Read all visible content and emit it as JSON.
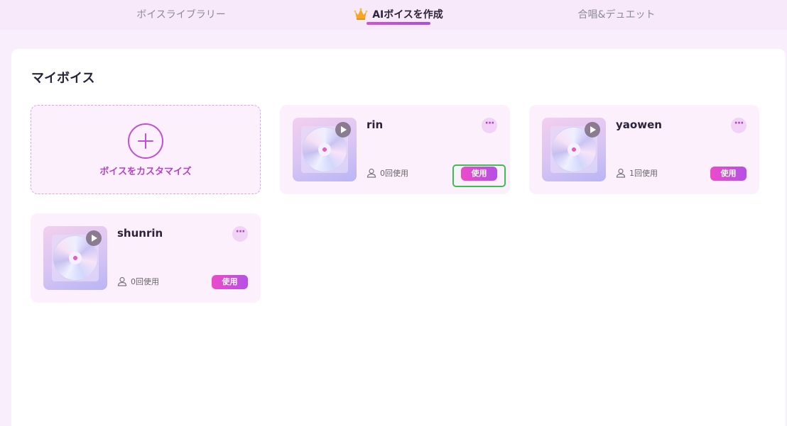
{
  "tabs": [
    {
      "label": "ボイスライブラリー",
      "active": false
    },
    {
      "label": "AIボイスを作成",
      "active": true,
      "icon": "crown-icon"
    },
    {
      "label": "合唱&デュエット",
      "active": false
    }
  ],
  "section": {
    "title": "マイボイス"
  },
  "add_card": {
    "label": "ボイスをカスタマイズ",
    "icon": "plus-circle-icon"
  },
  "voices": [
    {
      "name": "rin",
      "usage": "0回使用",
      "use_label": "使用",
      "highlighted": true
    },
    {
      "name": "yaowen",
      "usage": "1回使用",
      "use_label": "使用",
      "highlighted": false
    },
    {
      "name": "shunrin",
      "usage": "0回使用",
      "use_label": "使用",
      "highlighted": false
    }
  ],
  "colors": {
    "accent": "#c14fd6",
    "button_gradient_start": "#ec4bc9",
    "button_gradient_end": "#b550e6",
    "card_bg": "#fcf0fd",
    "highlight": "#3bbf54"
  }
}
